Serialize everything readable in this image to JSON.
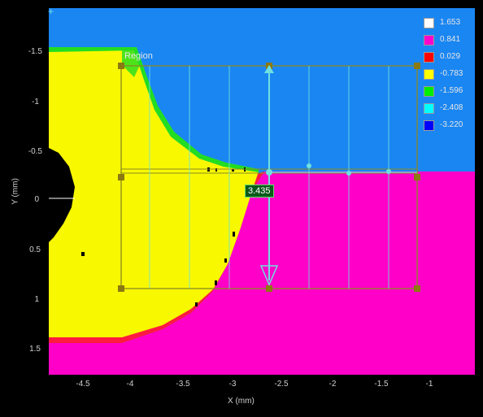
{
  "viewer": {
    "x_axis_label": "X (mm)",
    "y_axis_label": "Y (mm)",
    "x_ticks": [
      "-4.5",
      "-4",
      "-3.5",
      "-3",
      "-2.5",
      "-2",
      "-1.5",
      "-1"
    ],
    "y_ticks": [
      "-1.5",
      "-1",
      "-0.5",
      "0",
      "0.5",
      "1",
      "1.5"
    ],
    "region_label": "Region",
    "measurement_value": "3.435"
  },
  "legend": [
    {
      "value": "1.653",
      "color": "#ffffff"
    },
    {
      "value": "0.841",
      "color": "#ff00cc"
    },
    {
      "value": "0.029",
      "color": "#ff0000"
    },
    {
      "value": "-0.783",
      "color": "#ffff00"
    },
    {
      "value": "-1.596",
      "color": "#00ee00"
    },
    {
      "value": "-2.408",
      "color": "#00ffff"
    },
    {
      "value": "-3.220",
      "color": "#0000ff"
    }
  ],
  "colors": {
    "background": "#000000",
    "blue_region": "#1a86f2",
    "magenta_region": "#ff00c8",
    "yellow_region": "#f8f800",
    "green_edge": "#22dd22",
    "red_edge": "#ff1a40",
    "region_box": "#8a8a22",
    "measure_line": "#6fe0e0"
  }
}
